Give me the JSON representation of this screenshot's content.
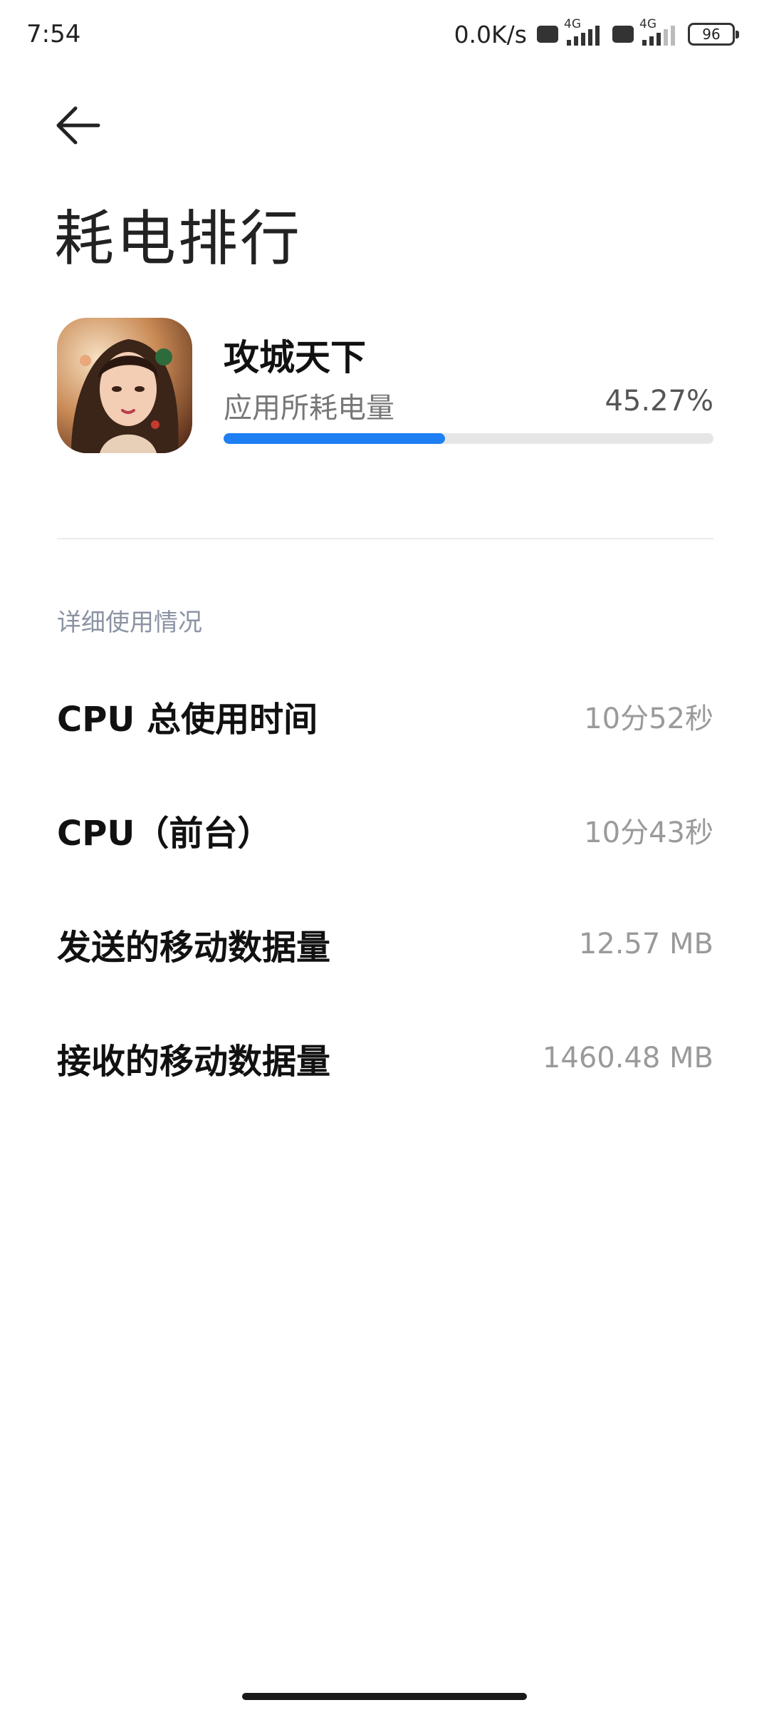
{
  "status_bar": {
    "time": "7:54",
    "net_speed": "0.0K/s",
    "sim1_network": "4G",
    "sim2_network": "4G",
    "battery": "96"
  },
  "page": {
    "title": "耗电排行"
  },
  "app": {
    "name": "攻城天下",
    "usage_label": "应用所耗电量",
    "usage_percent_text": "45.27%",
    "usage_fraction": 0.4527,
    "accent_color": "#1d7ff2"
  },
  "details": {
    "header": "详细使用情况",
    "rows": [
      {
        "label": "CPU 总使用时间",
        "value": "10分52秒"
      },
      {
        "label": "CPU（前台）",
        "value": "10分43秒"
      },
      {
        "label": "发送的移动数据量",
        "value": "12.57 MB"
      },
      {
        "label": "接收的移动数据量",
        "value": "1460.48 MB"
      }
    ]
  },
  "icons": {
    "back": "back-arrow-icon",
    "app_icon": "app-icon-portrait"
  }
}
